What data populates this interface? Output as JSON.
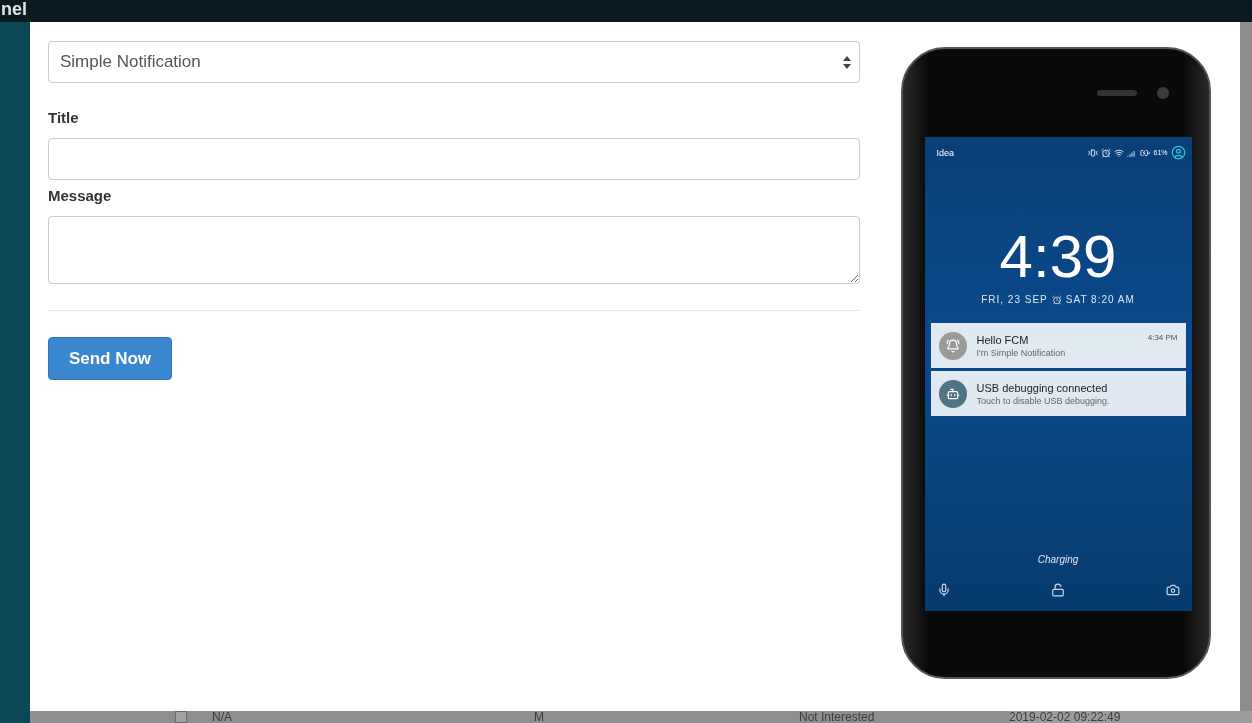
{
  "background": {
    "header_text": "nel",
    "row": {
      "checked": false,
      "cells": [
        "N/A",
        "M",
        "Not Interested",
        "2019-02-02 09:22:49"
      ]
    }
  },
  "form": {
    "type_select": {
      "value": "Simple Notification"
    },
    "fields": [
      {
        "label": "Title",
        "kind": "input"
      },
      {
        "label": "Message",
        "kind": "textarea"
      }
    ],
    "submit": "Send Now"
  },
  "phone": {
    "carrier": "Idea",
    "battery": "61%",
    "time": "4:39",
    "date": "FRI, 23 SEP",
    "alarm": "SAT 8:20 AM",
    "notifications": [
      {
        "title": "Hello FCM",
        "text": "I'm Simple Notification",
        "time": "4:34 PM",
        "kind": "app"
      },
      {
        "title": "USB debugging connected",
        "text": "Touch to disable USB debugging.",
        "kind": "system"
      }
    ],
    "status": "Charging"
  }
}
